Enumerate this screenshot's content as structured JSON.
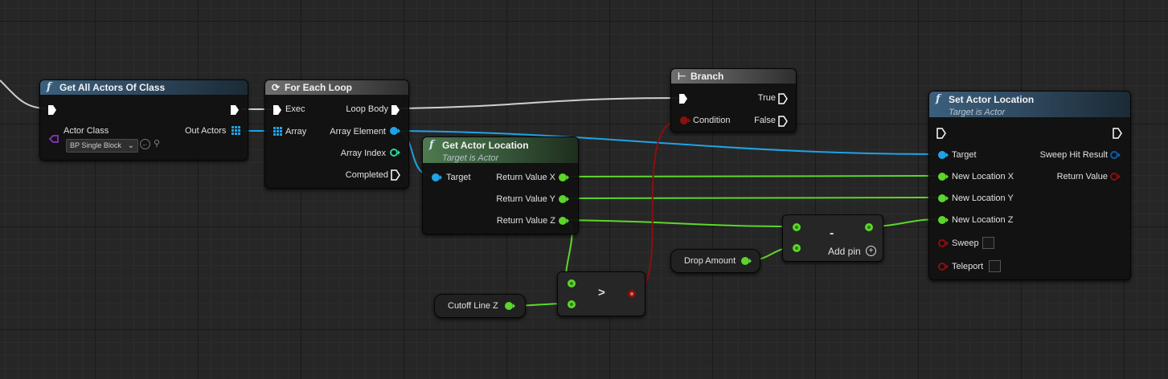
{
  "nodes": {
    "get_all_actors": {
      "title": "Get All Actors Of Class",
      "pin_actor_class": "Actor Class",
      "pin_out_actors": "Out Actors",
      "actor_class_value": "BP Single Block"
    },
    "for_each_loop": {
      "title": "For Each Loop",
      "pin_exec": "Exec",
      "pin_array": "Array",
      "pin_loop_body": "Loop Body",
      "pin_array_element": "Array Element",
      "pin_array_index": "Array Index",
      "pin_completed": "Completed"
    },
    "get_actor_location": {
      "title": "Get Actor Location",
      "subtitle": "Target is Actor",
      "pin_target": "Target",
      "pin_x": "Return Value X",
      "pin_y": "Return Value Y",
      "pin_z": "Return Value Z"
    },
    "branch": {
      "title": "Branch",
      "pin_condition": "Condition",
      "pin_true": "True",
      "pin_false": "False"
    },
    "set_actor_location": {
      "title": "Set Actor Location",
      "subtitle": "Target is Actor",
      "pin_target": "Target",
      "pin_new_x": "New Location X",
      "pin_new_y": "New Location Y",
      "pin_new_z": "New Location Z",
      "pin_sweep": "Sweep",
      "pin_teleport": "Teleport",
      "pin_sweep_hit": "Sweep Hit Result",
      "pin_return": "Return Value"
    },
    "subtract": {
      "symbol": "-",
      "add_pin": "Add pin"
    },
    "greater": {
      "symbol": ">"
    },
    "drop_amount": {
      "label": "Drop Amount"
    },
    "cutoff_line_z": {
      "label": "Cutoff Line Z"
    }
  },
  "colors": {
    "exec": "#ffffff",
    "float": "#5cd62a",
    "object": "#1fa3e6",
    "bool": "#8a0f0f",
    "class": "#7d2fb0",
    "struct": "#0e5aa6"
  },
  "icons": {
    "function": "f",
    "loop": "loop-icon",
    "branch": "branch-icon"
  }
}
